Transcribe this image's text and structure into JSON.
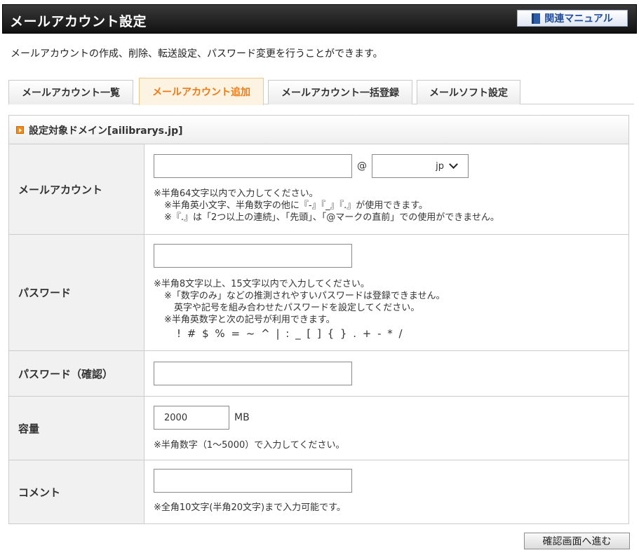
{
  "header": {
    "title": "メールアカウント設定",
    "manual_label": "関連マニュアル"
  },
  "intro": "メールアカウントの作成、削除、転送設定、パスワード変更を行うことができます。",
  "tabs": [
    {
      "label": "メールアカウント一覧",
      "active": false
    },
    {
      "label": "メールアカウント追加",
      "active": true
    },
    {
      "label": "メールアカウント一括登録",
      "active": false
    },
    {
      "label": "メールソフト設定",
      "active": false
    }
  ],
  "form": {
    "domain_heading": "設定対象ドメイン[ailibrarys.jp]",
    "account": {
      "label": "メールアカウント",
      "value": "",
      "at": "@",
      "domain_selected": "jp",
      "notes": [
        "※半角64文字以内で入力してください。",
        "※半角英小文字、半角数字の他に『-』『_』『.』が使用できます。",
        "※『.』は「2つ以上の連続」、「先頭」、「@マークの直前」での使用ができません。"
      ]
    },
    "password": {
      "label": "パスワード",
      "value": "",
      "notes": [
        "※半角8文字以上、15文字以内で入力してください。",
        "※「数字のみ」などの推測されやすいパスワードは登録できません。",
        "英字や記号を組み合わせたパスワードを設定してください。",
        "※半角英数字と次の記号が利用できます。",
        "! # $ % = ~ ^ | : _ [ ] { } . + - * /"
      ]
    },
    "password_confirm": {
      "label": "パスワード（確認）",
      "value": ""
    },
    "capacity": {
      "label": "容量",
      "value": "2000",
      "unit": "MB",
      "note": "※半角数字（1～5000）で入力してください。"
    },
    "comment": {
      "label": "コメント",
      "value": "",
      "note": "※全角10文字(半角20文字)まで入力可能です。"
    }
  },
  "submit_label": "確認画面へ進む",
  "colors": {
    "active_tab_text": "#f07a12",
    "header_bg": "#1a1a1a",
    "manual_text": "#224e9b"
  }
}
